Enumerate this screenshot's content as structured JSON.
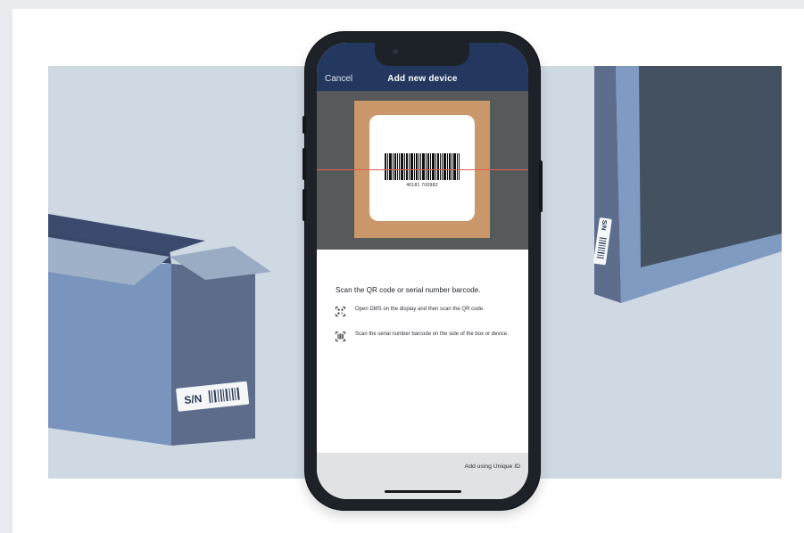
{
  "navbar": {
    "cancel_label": "Cancel",
    "title": "Add new device"
  },
  "scanner": {
    "barcode_number": "40181 700982"
  },
  "instructions": {
    "title": "Scan the QR code or serial number barcode.",
    "items": [
      {
        "icon": "qr-code-icon",
        "text": "Open DMS on the display and then scan the QR code."
      },
      {
        "icon": "barcode-scan-icon",
        "text": "Scan the serial number barcode on the side of the box or device."
      }
    ]
  },
  "footer": {
    "link_label": "Add using Unique ID"
  },
  "illustration": {
    "box_label": "S/N",
    "device_label": "S/N"
  },
  "colors": {
    "background": "#e9ebee",
    "panel": "#cfd9e4",
    "navbar": "#24375f",
    "kraft": "#c9976a",
    "scanline": "#e15b52",
    "box_front": "#7a95bd",
    "box_side": "#5c6c8a",
    "device_dark": "#445160"
  }
}
